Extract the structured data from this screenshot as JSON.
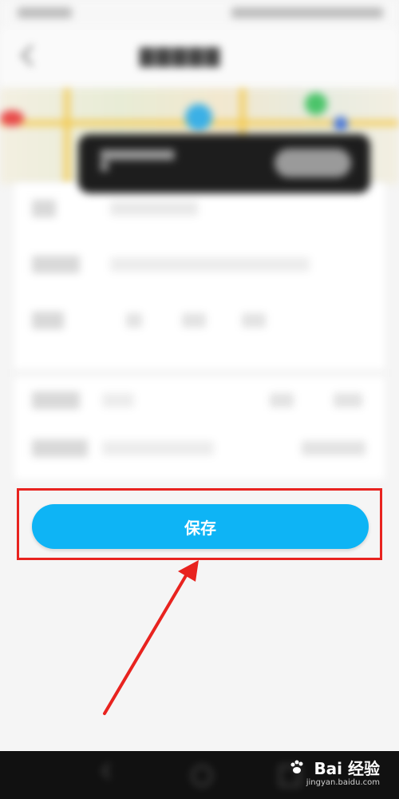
{
  "save_button": {
    "label": "保存"
  },
  "watermark": {
    "brand": "Bai 经验",
    "url": "jingyan.baidu.com"
  },
  "colors": {
    "button": "#0eb4f5",
    "highlight": "#e8231f",
    "nav_bar": "#111111"
  },
  "icons": {
    "back": "chevron-left-icon",
    "paw": "paw-icon"
  }
}
